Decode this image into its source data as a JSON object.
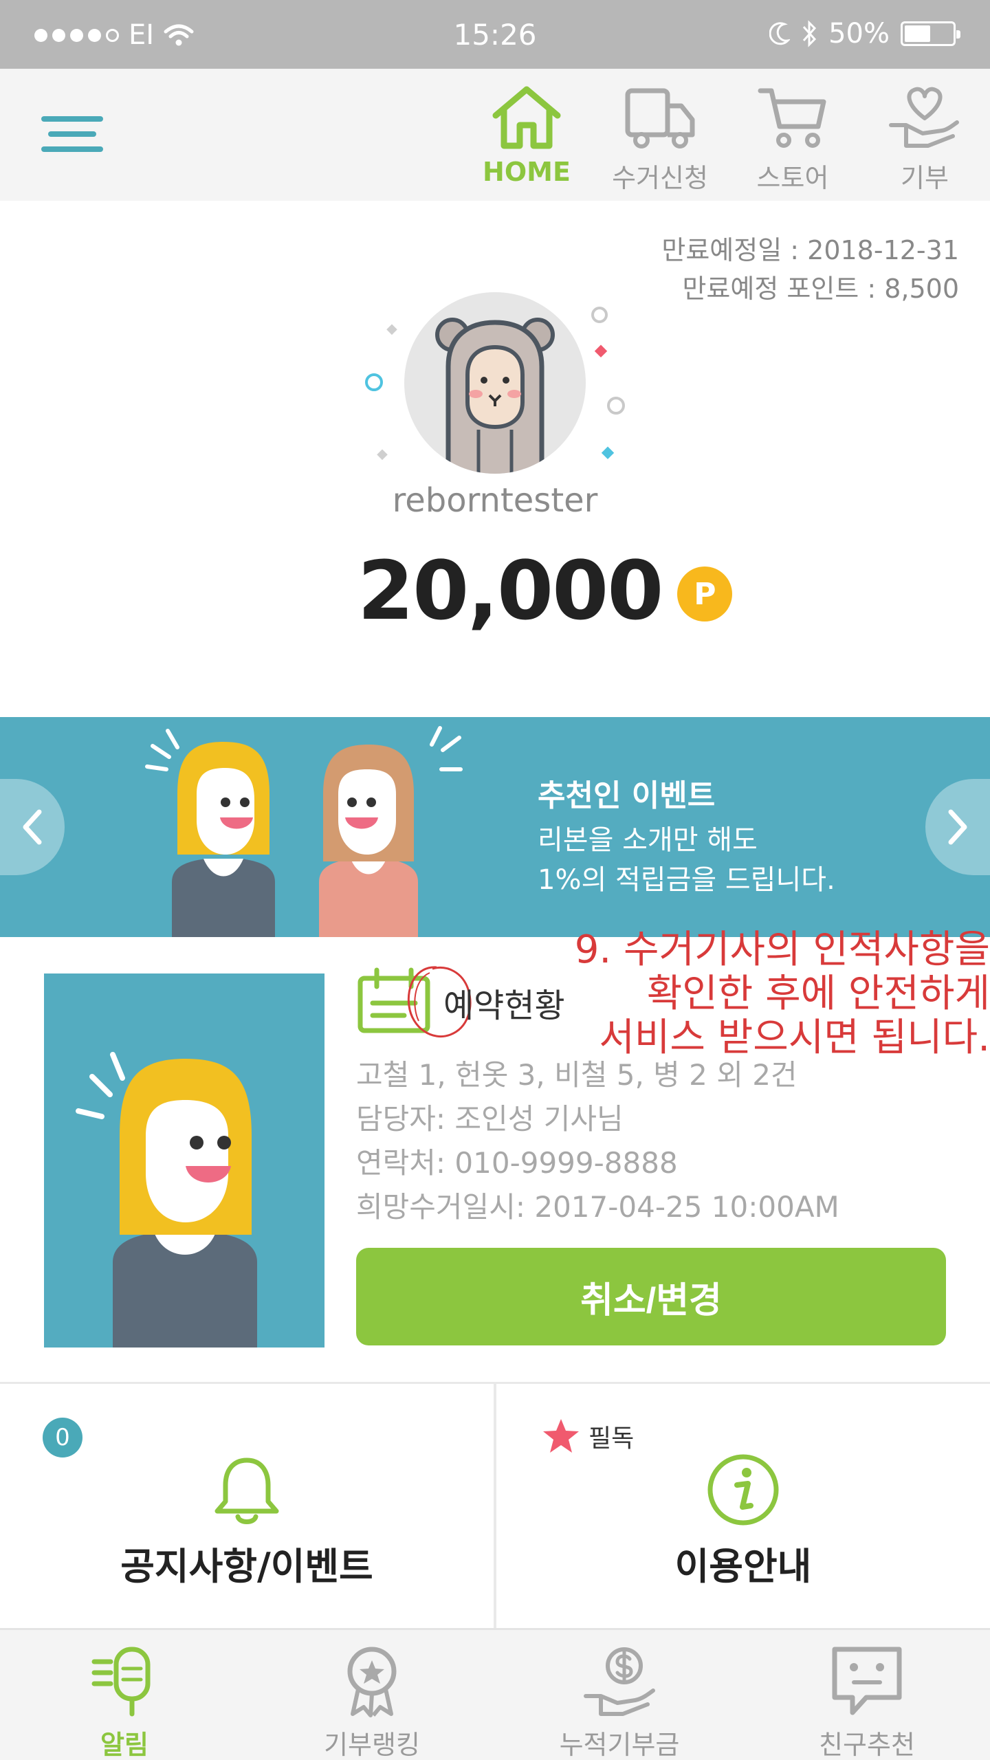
{
  "status_bar": {
    "carrier": "EI",
    "time": "15:26",
    "battery": "50%"
  },
  "top_nav": {
    "items": [
      {
        "label": "HOME",
        "icon": "home-icon",
        "active": true
      },
      {
        "label": "수거신청",
        "icon": "truck-icon",
        "active": false
      },
      {
        "label": "스토어",
        "icon": "cart-icon",
        "active": false
      },
      {
        "label": "기부",
        "icon": "heart-hand-icon",
        "active": false
      }
    ]
  },
  "expiry": {
    "date_line": "만료예정일 : 2018-12-31",
    "points_line": "만료예정 포인트 : 8,500"
  },
  "profile": {
    "username": "reborntester",
    "points": "20,000",
    "point_badge": "P"
  },
  "banner": {
    "title": "추천인 이벤트",
    "line1": "리본을 소개만 해도",
    "line2": "1%의 적립금을 드립니다."
  },
  "reservation": {
    "title": "예약현황",
    "items_line": "고철 1, 헌옷 3, 비철 5, 병 2 외 2건",
    "manager_line": "담당자: 조인성 기사님",
    "contact_line": "연락처: 010-9999-8888",
    "datetime_line": "희망수거일시: 2017-04-25 10:00AM",
    "button_label": "취소/변경",
    "annotation_line1": "9. 수거기사의 인적사항을",
    "annotation_line2": "확인한 후에 안전하게",
    "annotation_line3": "서비스 받으시면 됩니다."
  },
  "tiles": {
    "notice": {
      "badge": "0",
      "label": "공지사항/이벤트"
    },
    "guide": {
      "tag": "필독",
      "label": "이용안내"
    }
  },
  "tab_bar": {
    "items": [
      {
        "label": "알림",
        "active": true
      },
      {
        "label": "기부랭킹",
        "active": false
      },
      {
        "label": "누적기부금",
        "active": false
      },
      {
        "label": "친구추천",
        "active": false
      }
    ]
  },
  "colors": {
    "accent_green": "#8cc63f",
    "teal": "#54acc0",
    "coin": "#f8b81d",
    "annotation_red": "#d83a3a"
  }
}
